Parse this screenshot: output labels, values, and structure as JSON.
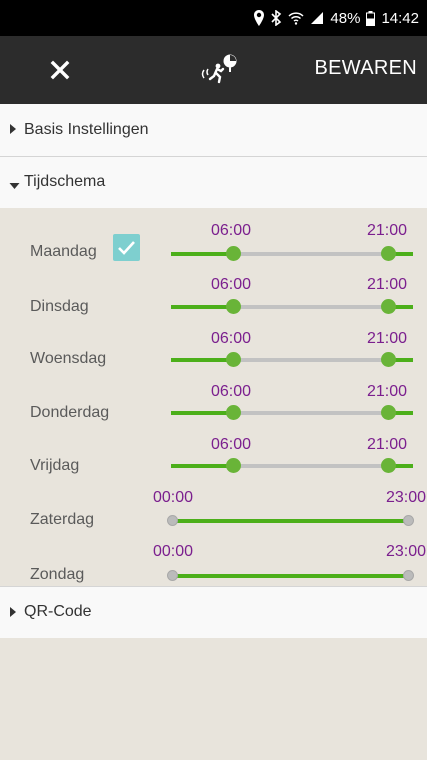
{
  "status_bar": {
    "battery": "48%",
    "time": "14:42",
    "icons": [
      "location-icon",
      "bluetooth-icon",
      "wifi-icon",
      "signal-icon",
      "battery-icon"
    ]
  },
  "app_bar": {
    "close_icon": "close-icon",
    "center_icon": "motion-sensor-icon",
    "save_label": "BEWAREN"
  },
  "sections": {
    "basis": {
      "label": "Basis Instellingen",
      "expanded": false
    },
    "schedule": {
      "label": "Tijdschema",
      "expanded": true
    },
    "qr": {
      "label": "QR-Code",
      "expanded": false
    }
  },
  "schedule": [
    {
      "day": "Maandag",
      "start": "06:00",
      "end": "21:00",
      "checked": true
    },
    {
      "day": "Dinsdag",
      "start": "06:00",
      "end": "21:00"
    },
    {
      "day": "Woensdag",
      "start": "06:00",
      "end": "21:00"
    },
    {
      "day": "Donderdag",
      "start": "06:00",
      "end": "21:00"
    },
    {
      "day": "Vrijdag",
      "start": "06:00",
      "end": "21:00"
    },
    {
      "day": "Zaterdag",
      "start": "00:00",
      "end": "23:00"
    },
    {
      "day": "Zondag",
      "start": "00:00",
      "end": "23:00"
    }
  ],
  "colors": {
    "accent_green": "#4caf1a",
    "time_purple": "#7b1f8e",
    "checkbox_teal": "#7ecfcf"
  }
}
